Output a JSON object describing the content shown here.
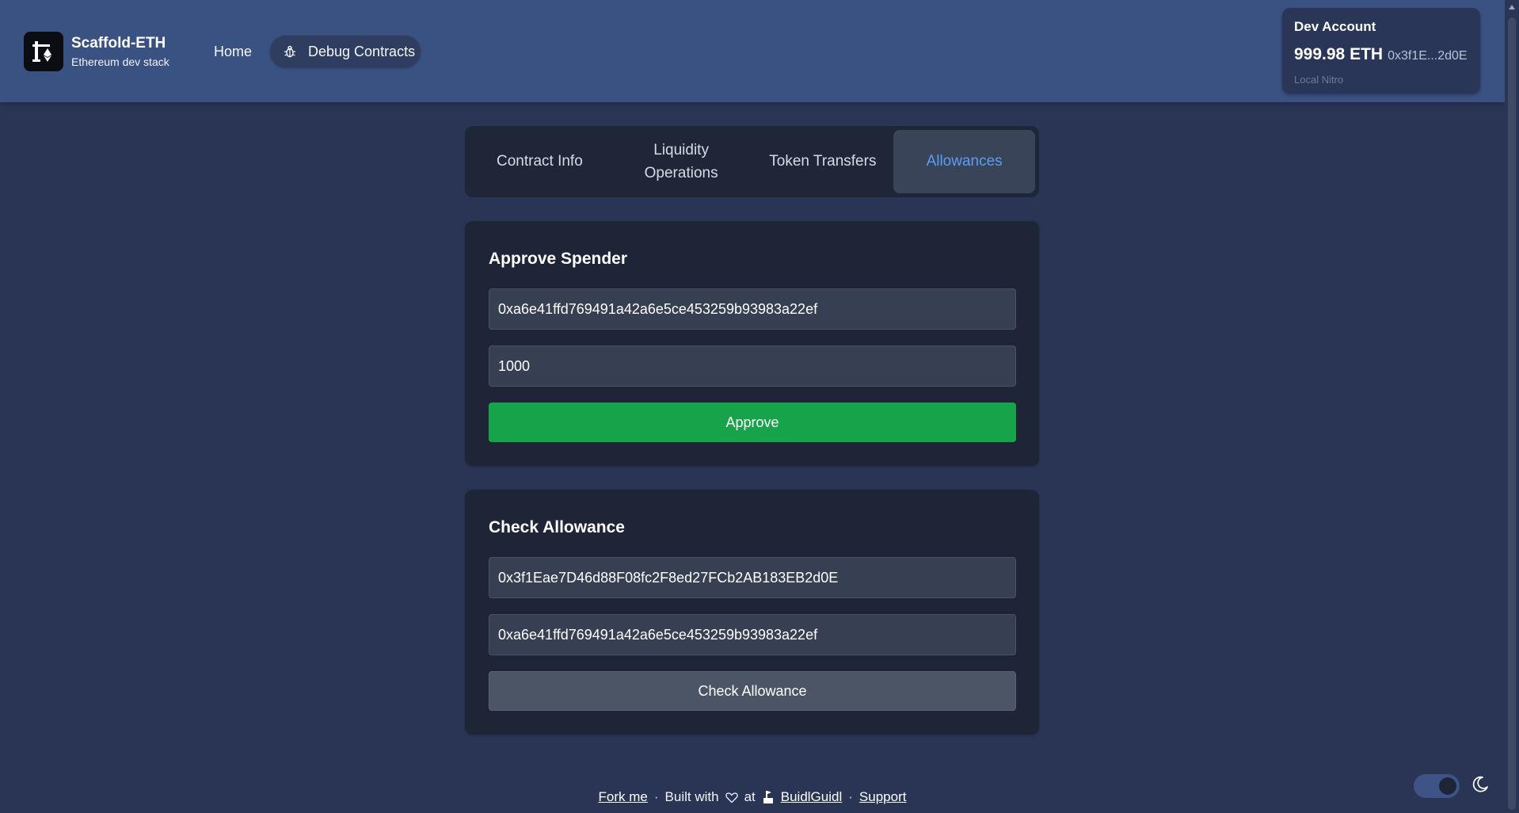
{
  "header": {
    "brand_title": "Scaffold-ETH",
    "brand_subtitle": "Ethereum dev stack",
    "nav": [
      {
        "label": "Home"
      },
      {
        "label": "Debug Contracts",
        "icon": "bug-icon"
      }
    ],
    "account": {
      "title": "Dev Account",
      "balance": "999.98 ETH",
      "address": "0x3f1E...2d0E",
      "network": "Local Nitro"
    }
  },
  "tabs": [
    {
      "label": "Contract Info",
      "active": false
    },
    {
      "label": "Liquidity\nOperations",
      "active": false
    },
    {
      "label": "Token Transfers",
      "active": false
    },
    {
      "label": "Allowances",
      "active": true
    }
  ],
  "approve": {
    "title": "Approve Spender",
    "spender": "0xa6e41ffd769491a42a6e5ce453259b93983a22ef",
    "amount": "1000",
    "button": "Approve"
  },
  "check": {
    "title": "Check Allowance",
    "owner": "0x3f1Eae7D46d88F08fc2F8ed27FCb2AB183EB2d0E",
    "spender": "0xa6e41ffd769491a42a6e5ce453259b93983a22ef",
    "button": "Check Allowance"
  },
  "footer": {
    "fork": "Fork me",
    "built_with": "Built with",
    "at": "at",
    "buidlguidl": "BuidlGuidl",
    "support": "Support",
    "separator": "·"
  },
  "colors": {
    "accent_tab": "#5b9cf5",
    "approve_button": "#16a34a",
    "header_bg": "#3a5282",
    "page_bg": "#2a3555"
  }
}
